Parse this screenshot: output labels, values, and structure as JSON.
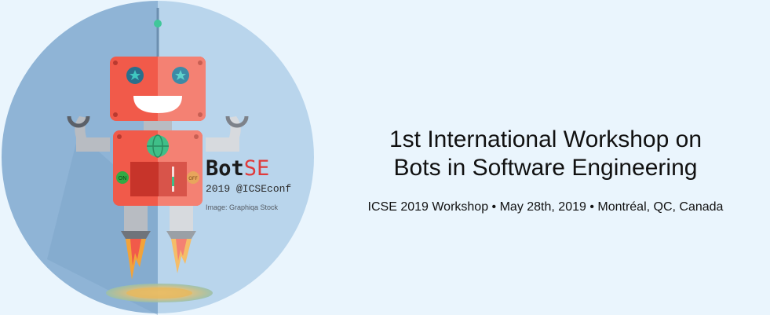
{
  "brand": {
    "name_bot": "Bot",
    "name_se": "SE",
    "tagline": "2019 @ICSEconf",
    "credit": "Image: Graphiqa Stock"
  },
  "robot": {
    "left_button_label": "ON",
    "right_button_label": "OFF"
  },
  "event": {
    "title_line1": "1st International Workshop on",
    "title_line2": "Bots in Software Engineering",
    "details": "ICSE 2019 Workshop • May 28th, 2019 • Montréal, QC, Canada"
  },
  "colors": {
    "background": "#eaf5fd",
    "circle_left": "#8fb4d6",
    "circle_right": "#b9d5ec",
    "robot_red": "#f15a4a",
    "brand_accent": "#e03a3a"
  },
  "icons": [
    "robot-illustration",
    "star-icon",
    "globe-icon",
    "flame-icon"
  ]
}
